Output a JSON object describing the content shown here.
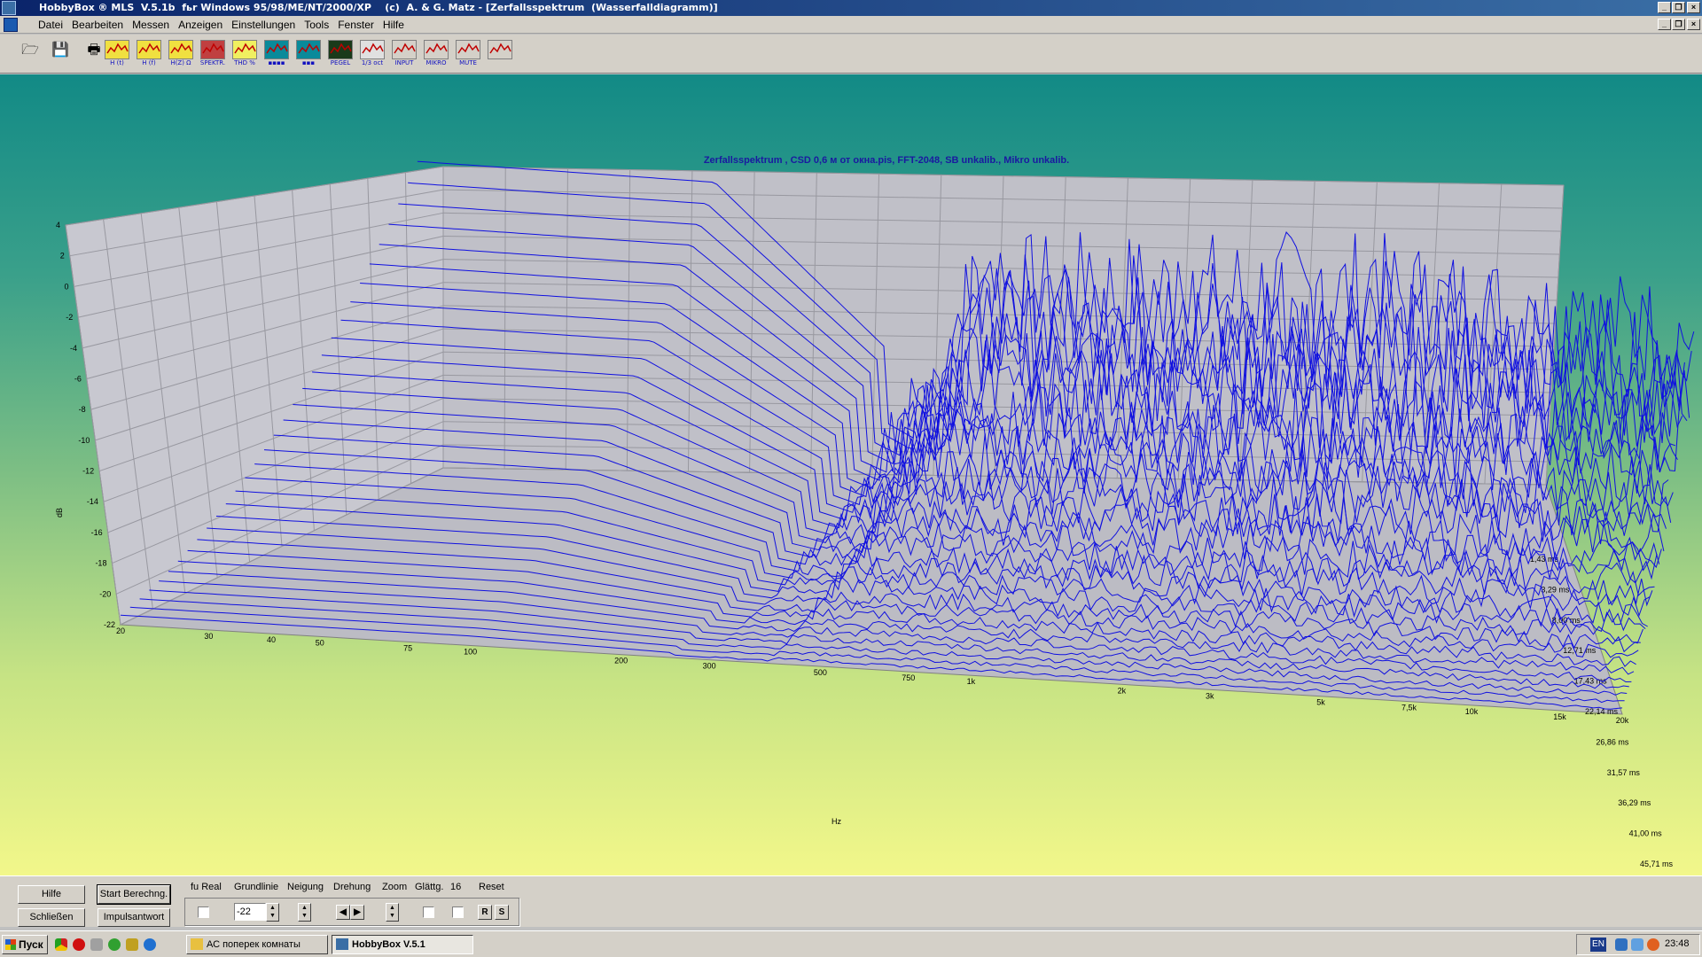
{
  "window": {
    "title": "HobbyBox ® MLS  V.5.1b  fьr Windows 95/98/ME/NT/2000/XP    (c)  A. & G. Matz - [Zerfallsspektrum  (Wasserfalldiagramm)]"
  },
  "menu": [
    "Datei",
    "Bearbeiten",
    "Messen",
    "Anzeigen",
    "Einstellungen",
    "Tools",
    "Fenster",
    "Hilfe"
  ],
  "toolbar": {
    "file_buttons": [
      "open-icon",
      "save-icon",
      "print-icon"
    ],
    "tools": [
      {
        "name": "impulse-response",
        "label": "H (t)"
      },
      {
        "name": "frequency-response",
        "label": "H (f)"
      },
      {
        "name": "impedance",
        "label": "H(Z) Ω"
      },
      {
        "name": "spectrogram",
        "label": "SPEKTR."
      },
      {
        "name": "thd",
        "label": "THD %"
      },
      {
        "name": "rta-spectrum",
        "label": "▪▪▪▪"
      },
      {
        "name": "rta-bars",
        "label": "▪▪▪"
      },
      {
        "name": "level-meter",
        "label": "PEGEL"
      },
      {
        "name": "third-octave",
        "label": "1/3 oct"
      },
      {
        "name": "input",
        "label": "INPUT"
      },
      {
        "name": "microphone",
        "label": "MIKRO"
      },
      {
        "name": "mute",
        "label": "MUTE"
      },
      {
        "name": "tool-extra",
        "label": ""
      }
    ]
  },
  "chart_data": {
    "type": "waterfall",
    "title": "Zerfallsspektrum , CSD 0,6 м от окна.pis, FFT-2048, SB unkalib., Mikro unkalib.",
    "xlabel": "Hz",
    "ylabel": "dB",
    "zlabel": "ms",
    "x_ticks": [
      "20",
      "30",
      "40",
      "50",
      "75",
      "100",
      "200",
      "300",
      "500",
      "750",
      "1k",
      "2k",
      "3k",
      "5k",
      "7,5k",
      "10k",
      "15k",
      "20k"
    ],
    "y_ticks": [
      "4",
      "2",
      "0",
      "-2",
      "-4",
      "-6",
      "-8",
      "-10",
      "-12",
      "-14",
      "-16",
      "-18",
      "-20",
      "-22"
    ],
    "z_ticks": [
      "1,43 ms",
      "3,29 ms",
      "8,00 ms",
      "12,71 ms",
      "17,43 ms",
      "22,14 ms",
      "26,86 ms",
      "31,57 ms",
      "36,29 ms",
      "41,00 ms",
      "45,71 ms"
    ],
    "xlim": [
      20,
      20000
    ],
    "ylim": [
      -22,
      4
    ],
    "zlim": [
      1.43,
      45.71
    ],
    "x_scale": "log",
    "grid": true,
    "line_color": "#1010e0",
    "panel_color": "#c0c0c8"
  },
  "controls": {
    "buttons": {
      "help": "Hilfe",
      "start": "Start Berechng.",
      "close": "Schließen",
      "impulse": "Impulsantwort"
    },
    "labels": {
      "fu_real": "fu Real",
      "grundlinie": "Grundlinie",
      "neigung": "Neigung",
      "drehung": "Drehung",
      "zoom": "Zoom",
      "glattg": "Glättg.",
      "glattg_value": "16",
      "reset": "Reset"
    },
    "grundlinie_value": "-22",
    "reset_buttons": [
      "R",
      "S"
    ]
  },
  "taskbar": {
    "start": "Пуск",
    "tasks": [
      {
        "label": "АС поперек комнаты",
        "active": false
      },
      {
        "label": "HobbyBox V.5.1",
        "active": true
      }
    ],
    "lang": "EN",
    "clock": "23:48"
  }
}
